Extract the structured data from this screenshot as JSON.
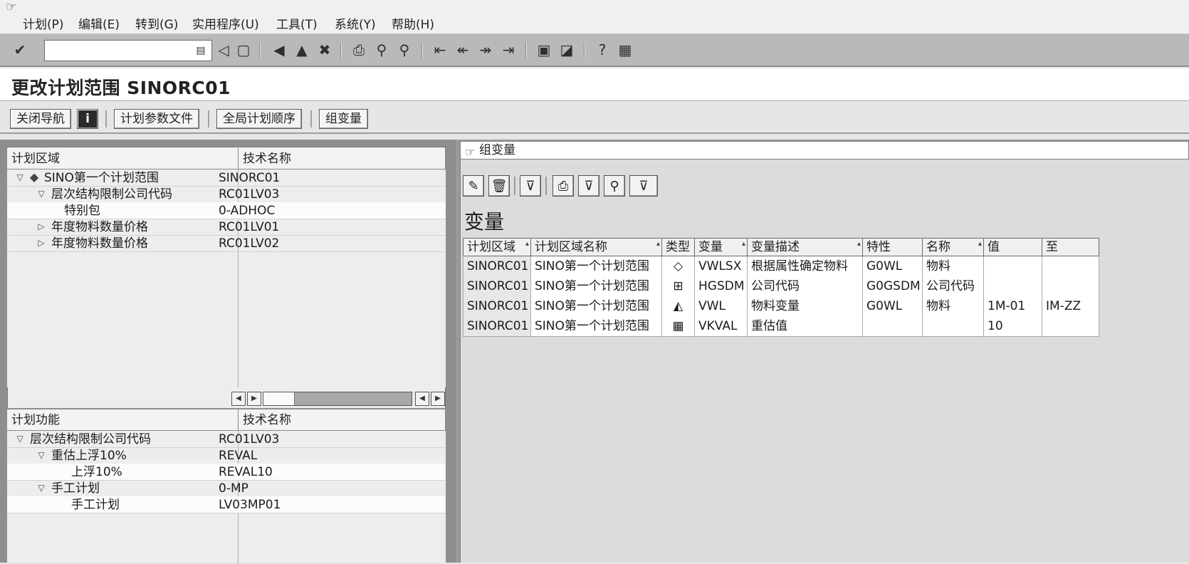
{
  "menu": [
    "计划(P)",
    "编辑(E)",
    "转到(G)",
    "实用程序(U)",
    "工具(T)",
    "系统(Y)",
    "帮助(H)"
  ],
  "toolbar": {
    "command_value": "",
    "icons": {
      "enter": "✔",
      "clipboard": "▤",
      "back_arrow": "◁",
      "save": "▢",
      "back": "◀",
      "exit": "▲",
      "cancel": "✖",
      "print": "⎙",
      "find": "⚲",
      "find_next": "⚲",
      "first_page": "⇤",
      "prev_page": "↞",
      "next_page": "↠",
      "last_page": "⇥",
      "new_session": "▣",
      "shortcut": "◪",
      "help": "?",
      "layout": "▦"
    }
  },
  "page": {
    "title": "更改计划范围 SINORC01"
  },
  "appbar": {
    "close_nav": "关闭导航",
    "info_icon": "i",
    "plan_param_file": "计划参数文件",
    "global_plan_seq": "全局计划顺序",
    "group_var": "组变量"
  },
  "area_tree": {
    "headers": [
      "计划区域",
      "技术名称"
    ],
    "rows": [
      {
        "indent": 0,
        "toggle": "▽",
        "icon": "◆",
        "label": "SINO第一个计划范围",
        "tech": "SINORC01",
        "selected": false
      },
      {
        "indent": 1,
        "toggle": "▽",
        "icon": "",
        "label": "层次结构限制公司代码",
        "tech": "RC01LV03",
        "selected": false
      },
      {
        "indent": 2,
        "toggle": "",
        "icon": "",
        "label": "特别包",
        "tech": "0-ADHOC",
        "selected": true
      },
      {
        "indent": 1,
        "toggle": "▷",
        "icon": "",
        "label": "年度物料数量价格",
        "tech": "RC01LV01",
        "selected": false
      },
      {
        "indent": 1,
        "toggle": "▷",
        "icon": "",
        "label": "年度物料数量价格",
        "tech": "RC01LV02",
        "selected": false
      }
    ]
  },
  "scroll": {
    "left": "◀",
    "right": "▶"
  },
  "func_tree": {
    "headers": [
      "计划功能",
      "技术名称"
    ],
    "rows": [
      {
        "indent": 0,
        "toggle": "▽",
        "label": "层次结构限制公司代码",
        "tech": "RC01LV03",
        "selected": false
      },
      {
        "indent": 1,
        "toggle": "▽",
        "label": "重估上浮10%",
        "tech": "REVAL",
        "selected": false
      },
      {
        "indent": 2,
        "toggle": "",
        "label": "上浮10%",
        "tech": "REVAL10",
        "selected": true
      },
      {
        "indent": 1,
        "toggle": "▽",
        "label": "手工计划",
        "tech": "0-MP",
        "selected": false
      },
      {
        "indent": 2,
        "toggle": "",
        "label": "手工计划",
        "tech": "LV03MP01",
        "selected": true
      }
    ]
  },
  "right": {
    "header_icon": "☞",
    "header": "组变量",
    "section_title": "变量",
    "alv_icons": [
      "✎",
      "🗑",
      "⊽",
      "⎙",
      "⊽",
      "⚲",
      "⊽"
    ],
    "columns": [
      "计划区域",
      "计划区域名称",
      "类型",
      "变量",
      "变量描述",
      "特性",
      "名称",
      "值",
      "至"
    ],
    "rows": [
      {
        "area": "SINORC01",
        "name": "SINO第一个计划范围",
        "type_icon": "◇",
        "var": "VWLSX",
        "desc": "根据属性确定物料",
        "char": "G0WL",
        "cname": "物料",
        "value": "",
        "to": ""
      },
      {
        "area": "SINORC01",
        "name": "SINO第一个计划范围",
        "type_icon": "⊞",
        "var": "HGSDM",
        "desc": "公司代码",
        "char": "G0GSDM",
        "cname": "公司代码",
        "value": "",
        "to": ""
      },
      {
        "area": "SINORC01",
        "name": "SINO第一个计划范围",
        "type_icon": "◭",
        "var": "VWL",
        "desc": "物料变量",
        "char": "G0WL",
        "cname": "物料",
        "value": "1M-01",
        "to": "IM-ZZ"
      },
      {
        "area": "SINORC01",
        "name": "SINO第一个计划范围",
        "type_icon": "▦",
        "var": "VKVAL",
        "desc": "重估值",
        "char": "",
        "cname": "",
        "value": "10",
        "to": ""
      }
    ]
  }
}
